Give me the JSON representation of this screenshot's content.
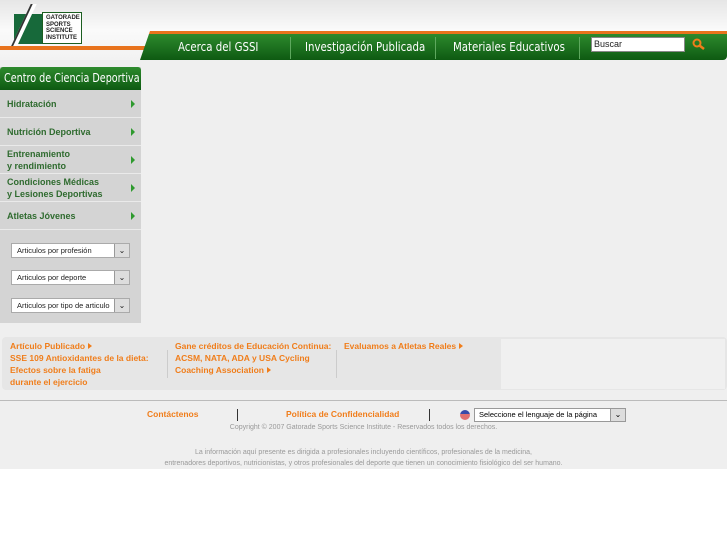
{
  "logo": {
    "text": "GATORADE SPORTS SCIENCE INSTITUTE"
  },
  "nav": {
    "items": [
      "Acerca del GSSI",
      "Investigación Publicada",
      "Materiales Educativos"
    ],
    "search_placeholder": "Buscar"
  },
  "sidebar": {
    "title": "Centro de Ciencia Deportiva",
    "items": [
      [
        "Hidratación"
      ],
      [
        "Nutrición Deportiva"
      ],
      [
        "Entrenamiento",
        "y rendimiento"
      ],
      [
        "Condiciones Médicas",
        "y Lesiones Deportivas"
      ],
      [
        "Atletas Jóvenes"
      ]
    ],
    "selects": [
      "Articulos por profesión",
      "Articulos por deporte",
      "Articulos por tipo de articulo"
    ]
  },
  "promo": {
    "col1": [
      "Artículo Publicado",
      "SSE 109 Antioxidantes de la dieta:",
      "Efectos sobre la fatiga",
      "durante el ejercicio"
    ],
    "col2": [
      "Gane créditos de Educación Continua:",
      "ACSM, NATA, ADA y USA Cycling",
      "Coaching Association"
    ],
    "col3": [
      "Evaluamos a Atletas Reales"
    ]
  },
  "footer": {
    "contact": "Contáctenos",
    "privacy": "Política de Confidencialidad",
    "language": "Seleccione el lenguaje de la página",
    "copyright": "Copyright © 2007 Gatorade Sports Science Institute - Reservados todos los derechos.",
    "info1": "La información aquí presente es dirigida a profesionales incluyendo científicos, profesionales de la medicina,",
    "info2": "entrenadores deportivos, nutricionistas, y otros profesionales del deporte que tienen un conocimiento fisiológico del ser humano."
  },
  "colors": {
    "green": "#0e5a12",
    "orange": "#f07d1a"
  }
}
